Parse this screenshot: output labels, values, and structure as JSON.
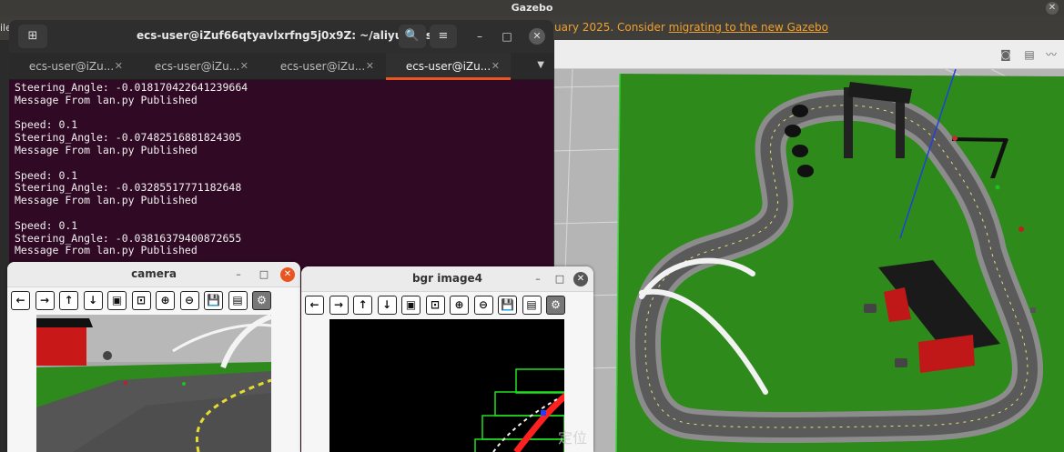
{
  "gazebo": {
    "title": "Gazebo",
    "close": "✕",
    "menu_left": "ile",
    "notice_prefix": "uary 2025. Consider ",
    "notice_link": "migrating to the new Gazebo",
    "toolbar_icons": [
      "camera-icon",
      "log-icon",
      "plot-icon"
    ],
    "toolbar_glyphs": [
      "◙",
      "▤",
      "〰"
    ]
  },
  "terminal": {
    "title": "ecs-user@iZuf66qtyavlxrfng5j0x9Z: ~/aliyun_ws",
    "new_tab_glyph": "⊞",
    "search_glyph": "🔍",
    "menu_glyph": "≡",
    "minimize": "–",
    "maximize": "□",
    "close": "✕",
    "tabs": [
      {
        "label": "ecs-user@iZu...",
        "close": "✕"
      },
      {
        "label": "ecs-user@iZu...",
        "close": "✕"
      },
      {
        "label": "ecs-user@iZu...",
        "close": "✕"
      },
      {
        "label": "ecs-user@iZu...",
        "close": "✕"
      }
    ],
    "tab_menu_glyph": "▼",
    "lines": [
      "Steering_Angle: -0.018170422641239664",
      "Message From lan.py Published",
      "",
      "Speed: 0.1",
      "Steering_Angle: -0.07482516881824305",
      "Message From lan.py Published",
      "",
      "Speed: 0.1",
      "Steering_Angle: -0.03285517771182648",
      "Message From lan.py Published",
      "",
      "Speed: 0.1",
      "Steering_Angle: -0.03816379400872655",
      "Message From lan.py Published"
    ]
  },
  "camera_window": {
    "title": "camera",
    "minimize": "–",
    "maximize": "□",
    "close": "✕"
  },
  "bgr_window": {
    "title": "bgr image4",
    "minimize": "–",
    "maximize": "□",
    "close": "✕"
  },
  "viewer_tools": [
    {
      "name": "arrow-left-icon",
      "glyph": "←"
    },
    {
      "name": "arrow-right-icon",
      "glyph": "→"
    },
    {
      "name": "arrow-up-icon",
      "glyph": "↑"
    },
    {
      "name": "arrow-down-icon",
      "glyph": "↓"
    },
    {
      "name": "zoom-fit-icon",
      "glyph": "▣"
    },
    {
      "name": "zoom-original-icon",
      "glyph": "⊡"
    },
    {
      "name": "zoom-in-icon",
      "glyph": "⊕"
    },
    {
      "name": "zoom-out-icon",
      "glyph": "⊖"
    },
    {
      "name": "save-icon",
      "glyph": "💾"
    },
    {
      "name": "properties-icon",
      "glyph": "▤"
    },
    {
      "name": "settings-icon",
      "glyph": "⚙"
    }
  ],
  "watermark": "定位",
  "colors": {
    "terminal_bg": "#300a24",
    "accent": "#e95420",
    "grass": "#2f8a1c",
    "track": "#555555"
  }
}
